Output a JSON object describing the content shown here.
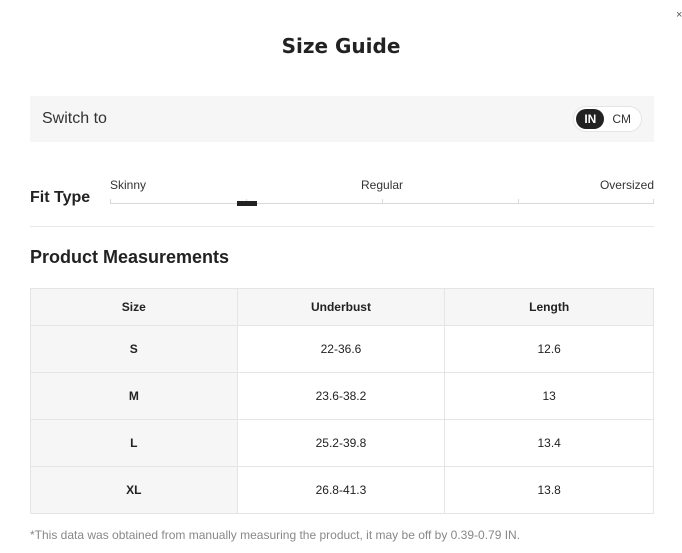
{
  "dialog": {
    "title": "Size Guide",
    "close_label": "×"
  },
  "unit_switch": {
    "label": "Switch to",
    "options": [
      "IN",
      "CM"
    ],
    "selected": "IN"
  },
  "fit_type": {
    "label": "Fit Type",
    "scale_labels": [
      "Skinny",
      "Regular",
      "Oversized"
    ],
    "marker_position": 0.25
  },
  "measurements": {
    "title": "Product Measurements",
    "columns": [
      "Size",
      "Underbust",
      "Length"
    ],
    "rows": [
      [
        "S",
        "22-36.6",
        "12.6"
      ],
      [
        "M",
        "23.6-38.2",
        "13"
      ],
      [
        "L",
        "25.2-39.8",
        "13.4"
      ],
      [
        "XL",
        "26.8-41.3",
        "13.8"
      ]
    ]
  },
  "footnote": "*This data was obtained from manually measuring the product, it may be off by 0.39-0.79 IN.",
  "colors": {
    "accent": "#222222",
    "panel_bg": "#f6f6f6",
    "border": "#e5e5e5"
  }
}
